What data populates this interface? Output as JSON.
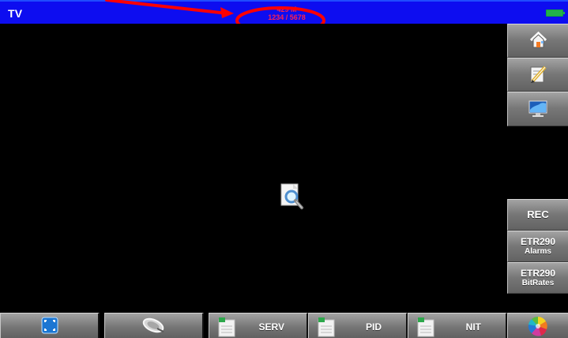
{
  "window": {
    "title": "TV"
  },
  "header": {
    "status_lines": [
      "429 M",
      "1234 / 5678"
    ],
    "battery_icon": "battery-icon",
    "accent": "#0d0df0",
    "status_color": "#ff1f4f",
    "battery_color": "#22b14c"
  },
  "annotation": {
    "arrow_icon": "annotation-arrow",
    "highlight_icon": "highlight-ellipse",
    "color": "#ff0000"
  },
  "main": {
    "video_background": "#000000",
    "loading_icon": "magnifier-document-icon"
  },
  "sidebar": {
    "items": [
      {
        "icon": "home-icon"
      },
      {
        "icon": "edit-icon"
      },
      {
        "icon": "monitor-icon"
      },
      {
        "label": "REC"
      },
      {
        "label": "ETR290",
        "sublabel": "Alarms"
      },
      {
        "label": "ETR290",
        "sublabel": "BitRates"
      },
      {
        "icon": "color-wheel-icon"
      }
    ]
  },
  "bottom_toolbar": {
    "buttons": [
      {
        "icon": "fullscreen-icon"
      },
      {
        "icon": "satellite-dish-icon"
      },
      {
        "label": "SERV",
        "icon": "document-icon"
      },
      {
        "label": "PID",
        "icon": "document-icon"
      },
      {
        "label": "NIT",
        "icon": "document-icon"
      }
    ]
  }
}
